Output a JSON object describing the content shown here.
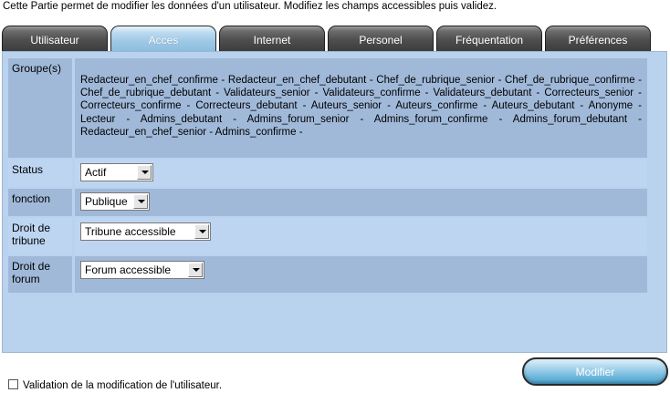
{
  "intro_text": "Cette Partie permet de modifier les données d'un utilisateur. Modifiez les champs accessibles puis validez.",
  "tabs": [
    {
      "label": "Utilisateur",
      "active": false
    },
    {
      "label": "Acces",
      "active": true
    },
    {
      "label": "Internet",
      "active": false
    },
    {
      "label": "Personel",
      "active": false
    },
    {
      "label": "Fréquentation",
      "active": false
    },
    {
      "label": "Préférences",
      "active": false
    }
  ],
  "form": {
    "groups": {
      "label": "Groupe(s)",
      "value": "Redacteur_en_chef_confirme - Redacteur_en_chef_debutant - Chef_de_rubrique_senior - Chef_de_rubrique_confirme - Chef_de_rubrique_debutant - Validateurs_senior - Validateurs_confirme - Validateurs_debutant - Correcteurs_senior - Correcteurs_confirme - Correcteurs_debutant - Auteurs_senior - Auteurs_confirme - Auteurs_debutant - Anonyme - Lecteur - Admins_debutant - Admins_forum_senior - Admins_forum_confirme - Admins_forum_debutant - Redacteur_en_chef_senior - Admins_confirme -"
    },
    "status": {
      "label": "Status",
      "value": "Actif"
    },
    "fonction": {
      "label": "fonction",
      "value": "Publique"
    },
    "droit_tribune": {
      "label": "Droit de tribune",
      "value": "Tribune accessible"
    },
    "droit_forum": {
      "label": "Droit de forum",
      "value": "Forum accessible"
    }
  },
  "validation": {
    "label": "Validation de la modification de l'utilisateur.",
    "checked": false
  },
  "submit_label": "Modifier"
}
